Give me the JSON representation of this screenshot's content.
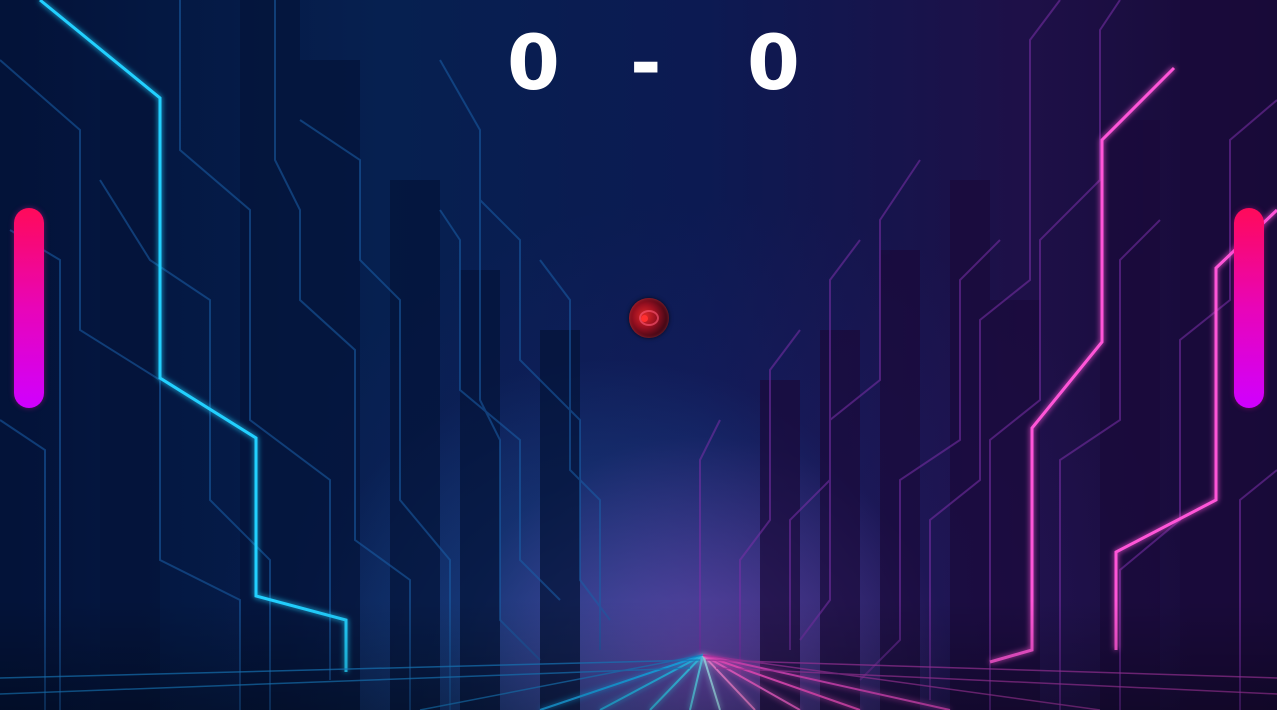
{
  "scoreboard": {
    "left_score": "0",
    "separator": "-",
    "right_score": "0"
  },
  "colors": {
    "paddle_top": "#ff0a5a",
    "paddle_bottom": "#d000ff",
    "neon_cyan": "#1ec8ff",
    "neon_magenta": "#ff4fd8",
    "score_text": "#ffffff"
  },
  "icons": {
    "ball": "red-orb-ball"
  }
}
